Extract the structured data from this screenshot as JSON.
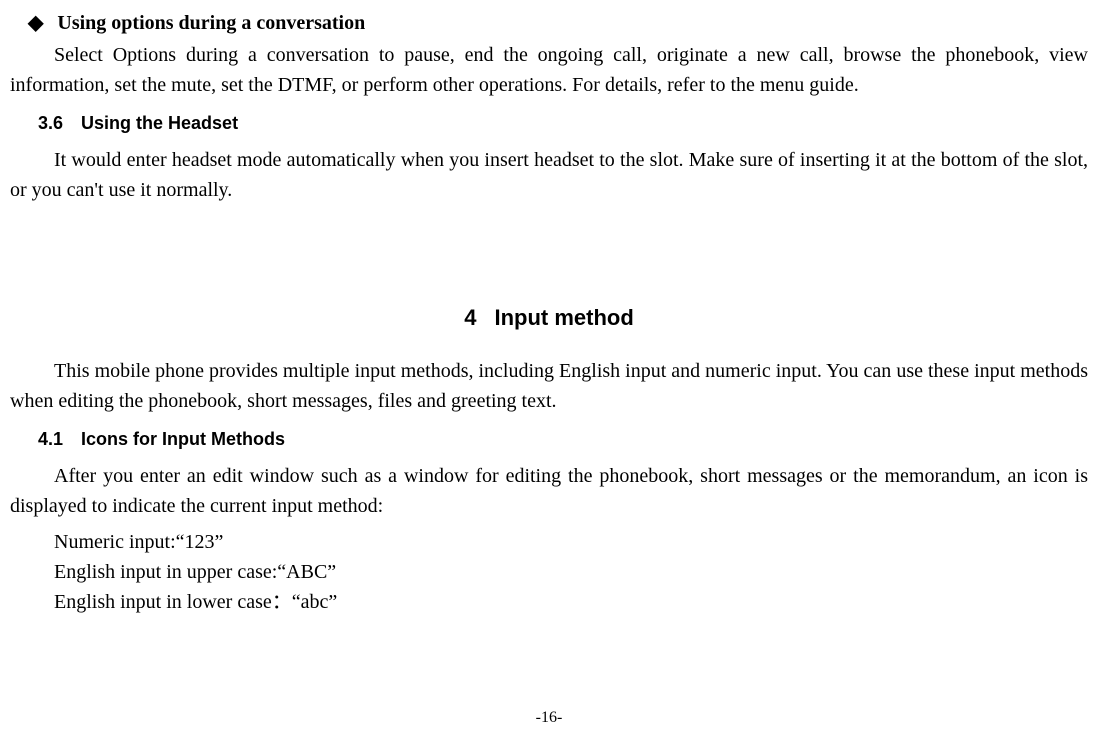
{
  "bullet_section": {
    "heading": "Using options during a conversation",
    "paragraph": "Select Options during a conversation to pause, end the ongoing call, originate a new call, browse the phonebook, view information, set the mute, set the DTMF, or perform other operations. For details, refer to the menu guide."
  },
  "section_3_6": {
    "number": "3.6",
    "title": "Using the Headset",
    "paragraph": "It would enter headset mode automatically when you insert headset to the slot. Make sure of inserting it at the bottom of the slot, or you can't use it normally."
  },
  "chapter_4": {
    "number": "4",
    "title": "Input method",
    "intro": "This mobile phone provides multiple input methods, including English input and numeric input. You can use these input methods when editing the phonebook, short messages, files and greeting text."
  },
  "section_4_1": {
    "number": "4.1",
    "title": "Icons for Input Methods",
    "paragraph": "After you enter an edit window such as a window for editing the phonebook, short messages or the memorandum, an icon is displayed to indicate the current input method:",
    "lines": {
      "numeric": "Numeric input:“123”",
      "upper": "English input in upper case:“ABC”",
      "lower": "English input in lower case：“abc”"
    }
  },
  "page_number": "-16-"
}
